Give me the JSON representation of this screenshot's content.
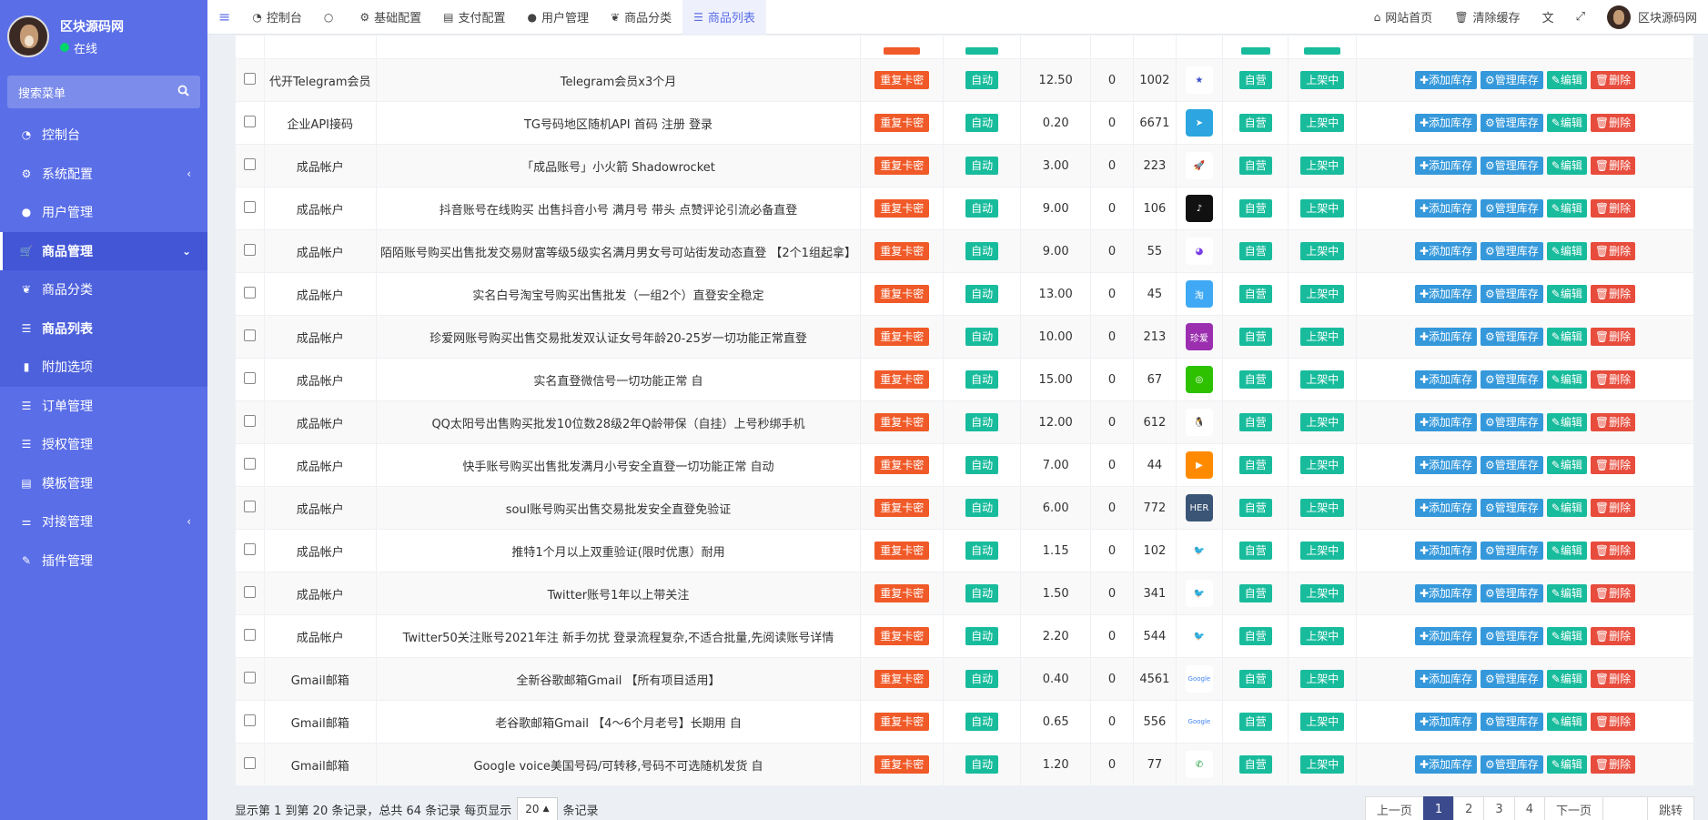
{
  "sidebar": {
    "user_name": "区块源码网",
    "status": "在线",
    "search_placeholder": "搜索菜单",
    "items": [
      {
        "label": "控制台",
        "icon": "dashboard-icon",
        "glyph": "◔"
      },
      {
        "label": "系统配置",
        "icon": "gear-icon",
        "glyph": "⚙",
        "chevron": "‹"
      },
      {
        "label": "用户管理",
        "icon": "user-icon",
        "glyph": "●"
      },
      {
        "label": "商品管理",
        "icon": "cart-icon",
        "glyph": "🛒",
        "chevron": "⌄"
      },
      {
        "label": "商品分类",
        "icon": "leaf-icon",
        "glyph": "❦"
      },
      {
        "label": "商品列表",
        "icon": "list-icon",
        "glyph": "☰"
      },
      {
        "label": "附加选项",
        "icon": "bookmark-icon",
        "glyph": "▮"
      },
      {
        "label": "订单管理",
        "icon": "bars-icon",
        "glyph": "☰"
      },
      {
        "label": "授权管理",
        "icon": "bars-icon",
        "glyph": "☰"
      },
      {
        "label": "模板管理",
        "icon": "template-icon",
        "glyph": "▤"
      },
      {
        "label": "对接管理",
        "icon": "sliders-icon",
        "glyph": "⚌",
        "chevron": "‹"
      },
      {
        "label": "插件管理",
        "icon": "plugin-icon",
        "glyph": "✎"
      }
    ]
  },
  "topbar": {
    "menu_toggle": "≡",
    "tabs": [
      {
        "label": "控制台",
        "glyph": "◔"
      },
      {
        "label": "",
        "glyph": "○"
      },
      {
        "label": "基础配置",
        "glyph": "⚙"
      },
      {
        "label": "支付配置",
        "glyph": "▤"
      },
      {
        "label": "用户管理",
        "glyph": "●"
      },
      {
        "label": "商品分类",
        "glyph": "❦"
      },
      {
        "label": "商品列表",
        "glyph": "☰"
      }
    ],
    "site_home": "网站首页",
    "clear_cache": "清除缓存",
    "user_name": "区块源码网"
  },
  "badges": {
    "type": "重复卡密",
    "delivery": "自动",
    "ownership": "自营",
    "status": "上架中",
    "add_stock": "✚添加库存",
    "manage_stock": "⚙管理库存",
    "edit": "✎编辑",
    "delete": "🗑删除"
  },
  "rows": [
    {
      "category": "代开Telegram会员",
      "name": "Telegram会员x3个月",
      "price": "12.50",
      "sold": "0",
      "stock": "1002",
      "img_bg": "#ffffff",
      "img_fg": "#3a4fc9",
      "img_text": "★"
    },
    {
      "category": "企业API接码",
      "name": "TG号码地区随机API 首码 注册 登录",
      "price": "0.20",
      "sold": "0",
      "stock": "6671",
      "img_bg": "#2ca5e0",
      "img_fg": "#ffffff",
      "img_text": "➤"
    },
    {
      "category": "成品帐户",
      "name": "「成品账号」小火箭 Shadowrocket",
      "price": "3.00",
      "sold": "0",
      "stock": "223",
      "img_bg": "#ffffff",
      "img_fg": "#6a6ad0",
      "img_text": "🚀"
    },
    {
      "category": "成品帐户",
      "name": "抖音账号在线购买 出售抖音小号 满月号 带头 点赞评论引流必备直登",
      "price": "9.00",
      "sold": "0",
      "stock": "106",
      "img_bg": "#111111",
      "img_fg": "#ffffff",
      "img_text": "♪"
    },
    {
      "category": "成品帐户",
      "name": "陌陌账号购买出售批发交易财富等级5级实名满月男女号可站街发动态直登 【2个1组起拿】",
      "price": "9.00",
      "sold": "0",
      "stock": "55",
      "img_bg": "#ffffff",
      "img_fg": "#7a3ee6",
      "img_text": "◕"
    },
    {
      "category": "成品帐户",
      "name": "实名白号淘宝号购买出售批发（一组2个）直登安全稳定",
      "price": "13.00",
      "sold": "0",
      "stock": "45",
      "img_bg": "#3fa9f5",
      "img_fg": "#ffffff",
      "img_text": "淘"
    },
    {
      "category": "成品帐户",
      "name": "珍爱网账号购买出售交易批发双认证女号年龄20-25岁一切功能正常直登",
      "price": "10.00",
      "sold": "0",
      "stock": "213",
      "img_bg": "#9b2fb0",
      "img_fg": "#ffffff",
      "img_text": "珍爱"
    },
    {
      "category": "成品帐户",
      "name": "实名直登微信号一切功能正常 自",
      "price": "15.00",
      "sold": "0",
      "stock": "67",
      "img_bg": "#2dc100",
      "img_fg": "#ffffff",
      "img_text": "◎"
    },
    {
      "category": "成品帐户",
      "name": "QQ太阳号出售购买批发10位数28级2年Q龄带保（自挂）上号秒绑手机",
      "price": "12.00",
      "sold": "0",
      "stock": "612",
      "img_bg": "#ffffff",
      "img_fg": "#111111",
      "img_text": "🐧"
    },
    {
      "category": "成品帐户",
      "name": "快手账号购买出售批发满月小号安全直登一切功能正常 自动",
      "price": "7.00",
      "sold": "0",
      "stock": "44",
      "img_bg": "#ff8a00",
      "img_fg": "#ffffff",
      "img_text": "▶"
    },
    {
      "category": "成品帐户",
      "name": "soul账号购买出售交易批发安全直登免验证",
      "price": "6.00",
      "sold": "0",
      "stock": "772",
      "img_bg": "#3b5576",
      "img_fg": "#ffffff",
      "img_text": "HER"
    },
    {
      "category": "成品帐户",
      "name": "推特1个月以上双重验证(限时优惠）耐用",
      "price": "1.15",
      "sold": "0",
      "stock": "102",
      "img_bg": "#ffffff",
      "img_fg": "#1da1f2",
      "img_text": "🐦"
    },
    {
      "category": "成品帐户",
      "name": "Twitter账号1年以上带关注",
      "price": "1.50",
      "sold": "0",
      "stock": "341",
      "img_bg": "#ffffff",
      "img_fg": "#1da1f2",
      "img_text": "🐦"
    },
    {
      "category": "成品帐户",
      "name": "Twitter50关注账号2021年注 新手勿扰 登录流程复杂,不适合批量,先阅读账号详情",
      "price": "2.20",
      "sold": "0",
      "stock": "544",
      "img_bg": "#ffffff",
      "img_fg": "#1da1f2",
      "img_text": "🐦"
    },
    {
      "category": "Gmail邮箱",
      "name": "全新谷歌邮箱Gmail 【所有项目适用】",
      "price": "0.40",
      "sold": "0",
      "stock": "4561",
      "img_bg": "#ffffff",
      "img_fg": "#4285f4",
      "img_text": "Google"
    },
    {
      "category": "Gmail邮箱",
      "name": "老谷歌邮箱Gmail 【4～6个月老号】长期用 自",
      "price": "0.65",
      "sold": "0",
      "stock": "556",
      "img_bg": "#ffffff",
      "img_fg": "#4285f4",
      "img_text": "Google"
    },
    {
      "category": "Gmail邮箱",
      "name": "Google voice美国号码/可转移,号码不可选随机发货 自",
      "price": "1.20",
      "sold": "0",
      "stock": "77",
      "img_bg": "#ffffff",
      "img_fg": "#1a9e35",
      "img_text": "✆"
    }
  ],
  "footer": {
    "summary_prefix": "显示第 1 到第 20 条记录，总共 64 条记录 每页显示",
    "page_size": "20",
    "caret": "▲",
    "summary_suffix": "条记录",
    "prev": "上一页",
    "pages": [
      "1",
      "2",
      "3",
      "4"
    ],
    "next": "下一页",
    "jump": "跳转"
  }
}
